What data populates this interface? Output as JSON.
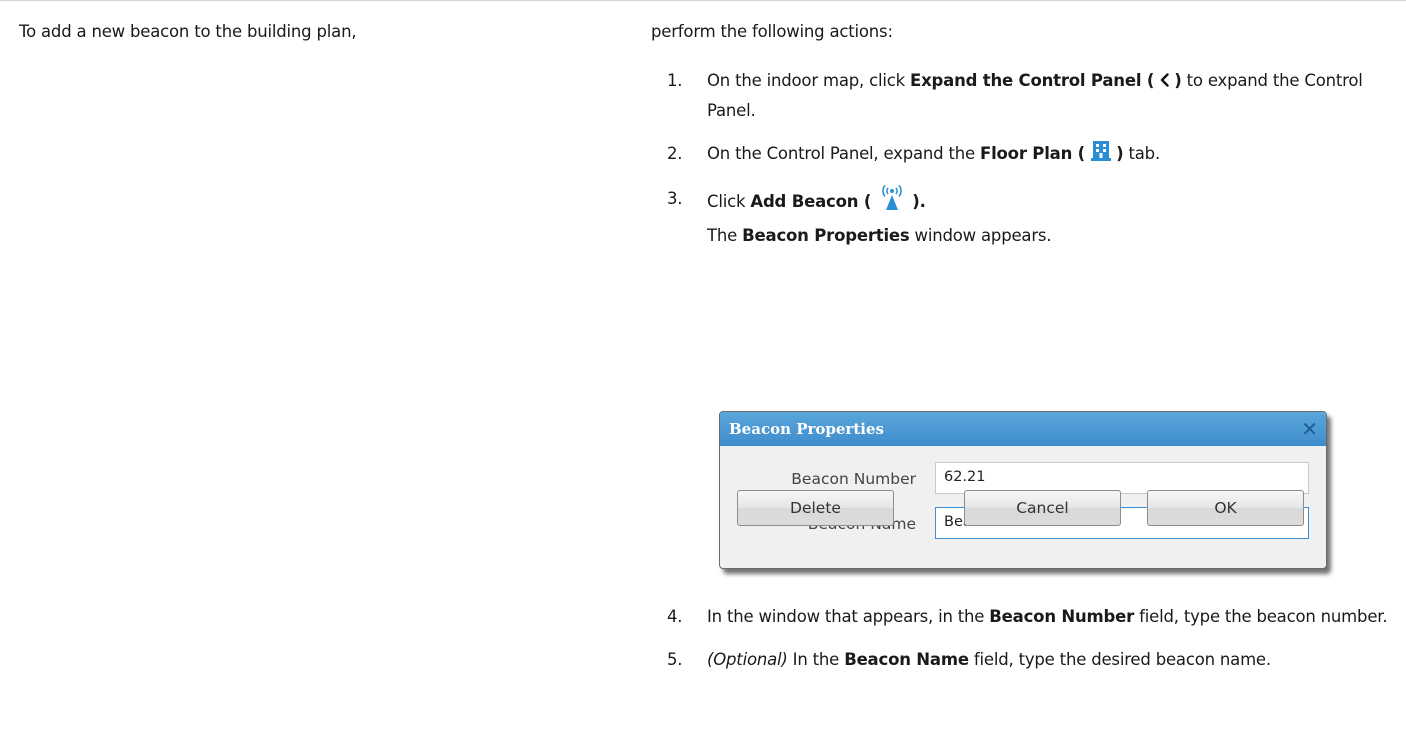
{
  "intro": {
    "left": "To add a new beacon to the building plan,",
    "right": "perform the following actions:"
  },
  "steps": [
    {
      "number": "1.",
      "part1": "On the indoor map, click ",
      "bold1": "Expand the Control Panel (",
      "icon": "chevron-left-icon",
      "bold2": ")",
      "part2": " to expand the Control Panel."
    },
    {
      "number": "2.",
      "part1": "On the Control Panel, expand the ",
      "bold1": "Floor Plan (",
      "icon": "building-icon",
      "bold2": ")",
      "part2": " tab."
    },
    {
      "number": "3.",
      "part1": "Click ",
      "bold1": "Add Beacon (",
      "icon": "beacon-icon",
      "bold2": ").",
      "line2_prefix": "The ",
      "line2_bold": "Beacon Properties",
      "line2_suffix": " window appears."
    },
    {
      "number": "4.",
      "part1": "In the window that appears, in the ",
      "bold1": "Beacon Number",
      "part2": " field, type the beacon number."
    },
    {
      "number": "5.",
      "italic": "(Optional)",
      "part1": " In the ",
      "bold1": "Beacon Name",
      "part2": " field, type the desired beacon name."
    }
  ],
  "dialog": {
    "title": "Beacon Properties",
    "close_icon": "close-icon",
    "fields": [
      {
        "label": "Beacon Number",
        "value": "62.21"
      },
      {
        "label": "Beacon Name",
        "value": "Beacon 1"
      }
    ],
    "buttons": {
      "delete": "Delete",
      "cancel": "Cancel",
      "ok": "OK"
    }
  },
  "colors": {
    "title_bar": "#4a98d4",
    "icon_blue": "#2b8fd6",
    "focus_border": "#3b8dd4"
  }
}
